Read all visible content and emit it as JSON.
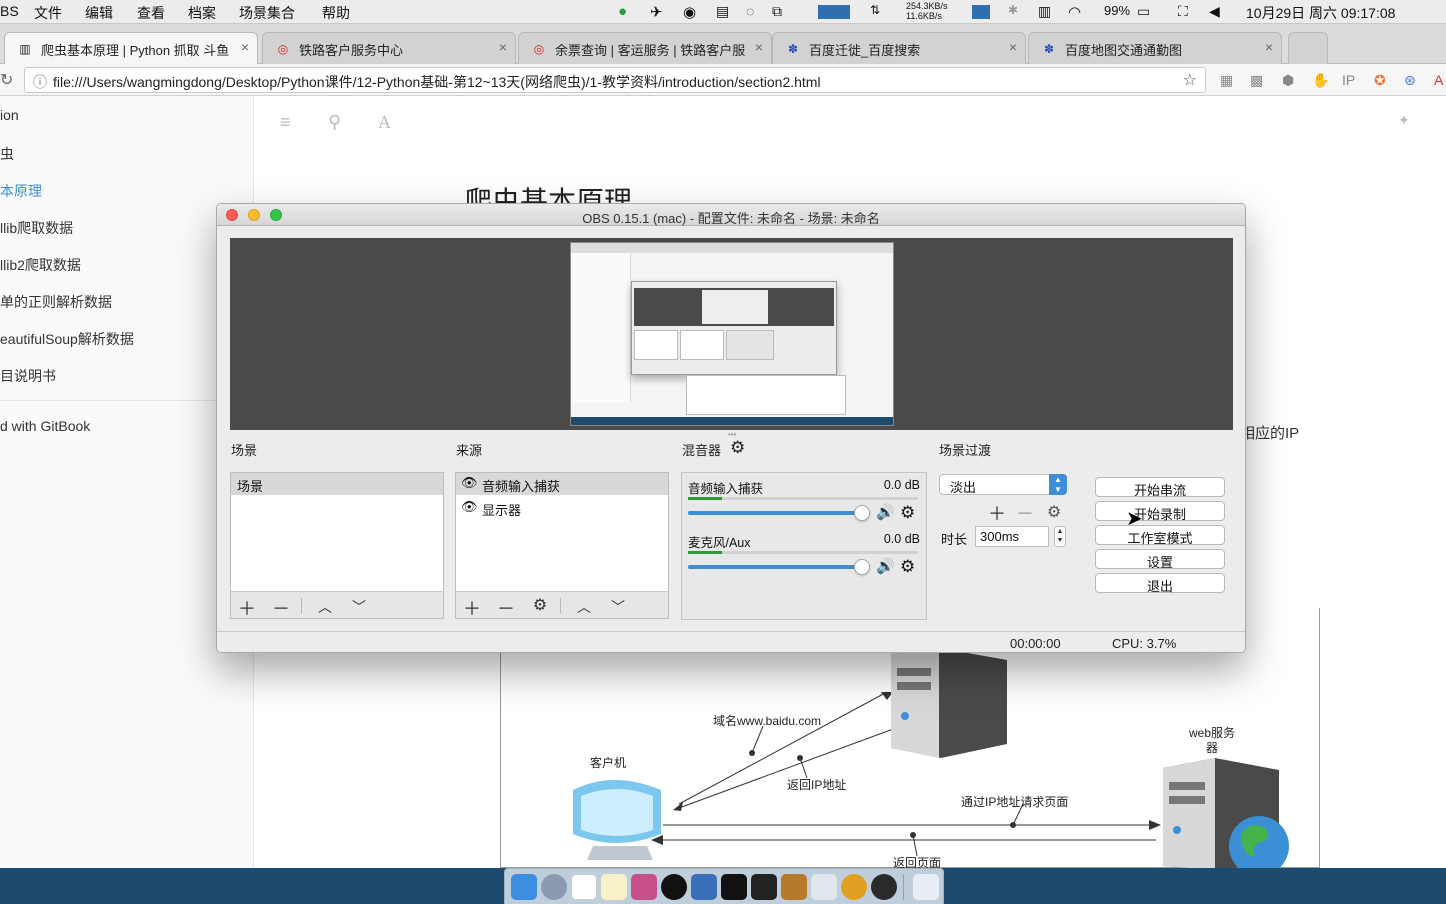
{
  "menubar": {
    "items": [
      "BS",
      "文件",
      "编辑",
      "查看",
      "档案",
      "场景集合",
      "帮助"
    ],
    "net_up": "254.3KB/s",
    "net_down": "11.6KB/s",
    "battery": "99%",
    "datetime": "10月29日 周六 09:17:08"
  },
  "tabs": [
    {
      "label": "爬虫基本原理 | Python 抓取 斗鱼"
    },
    {
      "label": "铁路客户服务中心"
    },
    {
      "label": "余票查询 | 客运服务 | 铁路客户服"
    },
    {
      "label": "百度迁徙_百度搜索"
    },
    {
      "label": "百度地图交通通勤图"
    }
  ],
  "address": {
    "url": "file:///Users/wangmingdong/Desktop/Python课件/12-Python基础-第12~13天(网络爬虫)/1-教学资料/introduction/section2.html"
  },
  "gitbook": {
    "nav": [
      "ion",
      "虫",
      "本原理",
      "llib爬取数据",
      "llib2爬取数据",
      "单的正则解析数据",
      "eautifulSoup解析数据",
      "目说明书",
      "d with GitBook"
    ],
    "title": "爬虫基本原理",
    "body_fragment": "相应的IP",
    "diagram": {
      "domain": "域名www.baidu.com",
      "client": "客户机",
      "return_ip": "返回IP地址",
      "request": "通过IP地址请求页面",
      "web_server": "web服务\n器",
      "return_page": "返回页面"
    }
  },
  "obs": {
    "title": "OBS 0.15.1 (mac) - 配置文件: 未命名 - 场景: 未命名",
    "scenes_header": "场景",
    "scenes": [
      "场景"
    ],
    "sources_header": "来源",
    "sources": [
      "音频输入捕获",
      "显示器"
    ],
    "mixer_header": "混音器",
    "mixer": [
      {
        "name": "音频输入捕获",
        "db": "0.0 dB",
        "volume": 1.0
      },
      {
        "name": "麦克风/Aux",
        "db": "0.0 dB",
        "volume": 1.0
      }
    ],
    "transition_header": "场景过渡",
    "transition": "淡出",
    "duration_label": "时长",
    "duration": "300ms",
    "buttons": [
      "开始串流",
      "开始录制",
      "工作室模式",
      "设置",
      "退出"
    ],
    "status_time": "00:00:00",
    "status_cpu": "CPU: 3.7%"
  }
}
